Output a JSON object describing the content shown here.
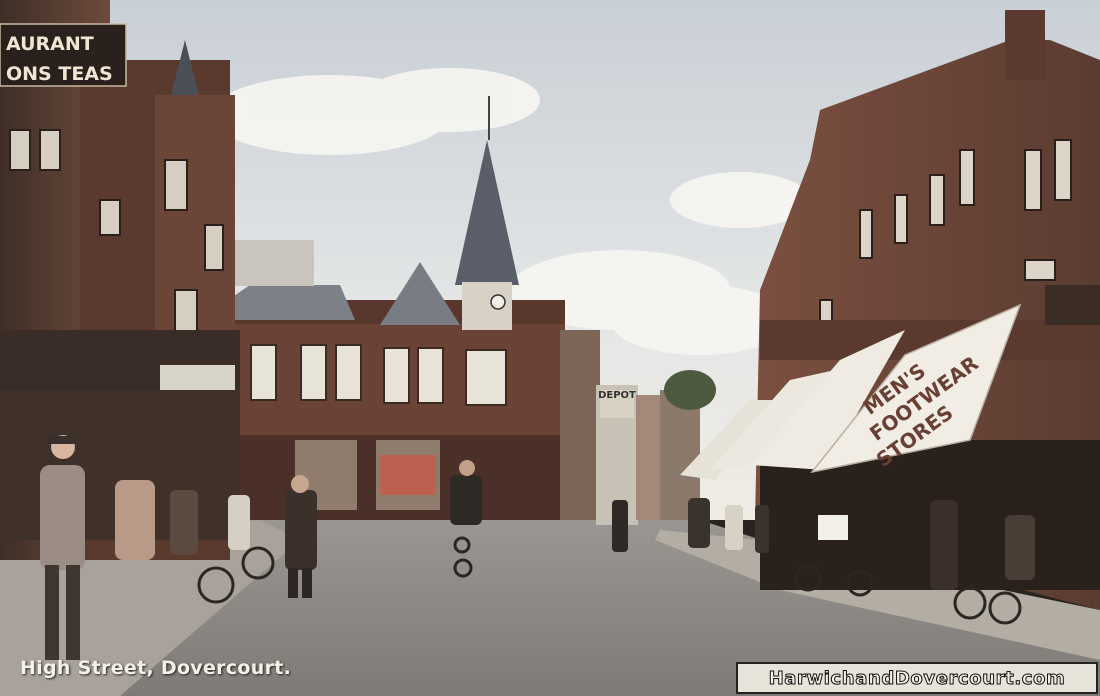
{
  "caption": "High Street, Dovercourt.",
  "watermark": "HarwichandDovercourt.com",
  "signs": {
    "restaurant_line1": "AURANT",
    "restaurant_line2": "ONS TEAS",
    "awning_line1": "MEN'S",
    "awning_line2": "FOOTWEAR",
    "awning_line3": "STORES",
    "depot": "DEPOT"
  },
  "colors": {
    "sky": "#dfe3e6",
    "brick": "#7a4a38",
    "road": "#8d8a86",
    "awning": "#ece8df"
  }
}
